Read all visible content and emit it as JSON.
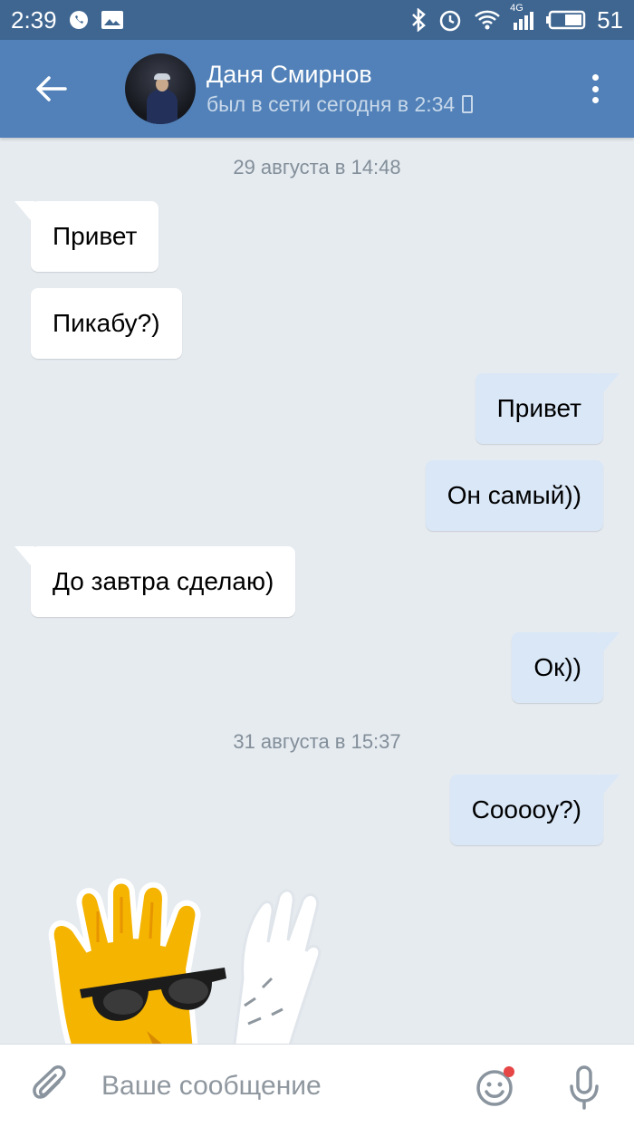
{
  "status_bar": {
    "time": "2:39",
    "network": "4G",
    "battery": "51",
    "icons": [
      "whatsapp-icon",
      "image-icon",
      "bluetooth-icon",
      "alarm-icon",
      "wifi-icon",
      "signal-icon",
      "battery-icon"
    ]
  },
  "header": {
    "contact_name": "Даня Смирнов",
    "contact_status": "был в сети сегодня в 2:34",
    "accent_color": "#5181b8"
  },
  "chat": {
    "date_separators": [
      "29 августа в 14:48",
      "31 августа в 15:37"
    ],
    "messages": [
      {
        "direction": "in",
        "text": "Привет"
      },
      {
        "direction": "in",
        "text": "Пикабу?)"
      },
      {
        "direction": "out",
        "text": "Привет"
      },
      {
        "direction": "out",
        "text": "Он самый))"
      },
      {
        "direction": "in",
        "text": "До завтра сделаю)"
      },
      {
        "direction": "out",
        "text": "Ок))"
      },
      {
        "direction": "out",
        "text": "Cooooy?)"
      }
    ],
    "incoming_bubble_color": "#ffffff",
    "outgoing_bubble_color": "#d9e7f7"
  },
  "input": {
    "placeholder": "Ваше сообщение"
  }
}
